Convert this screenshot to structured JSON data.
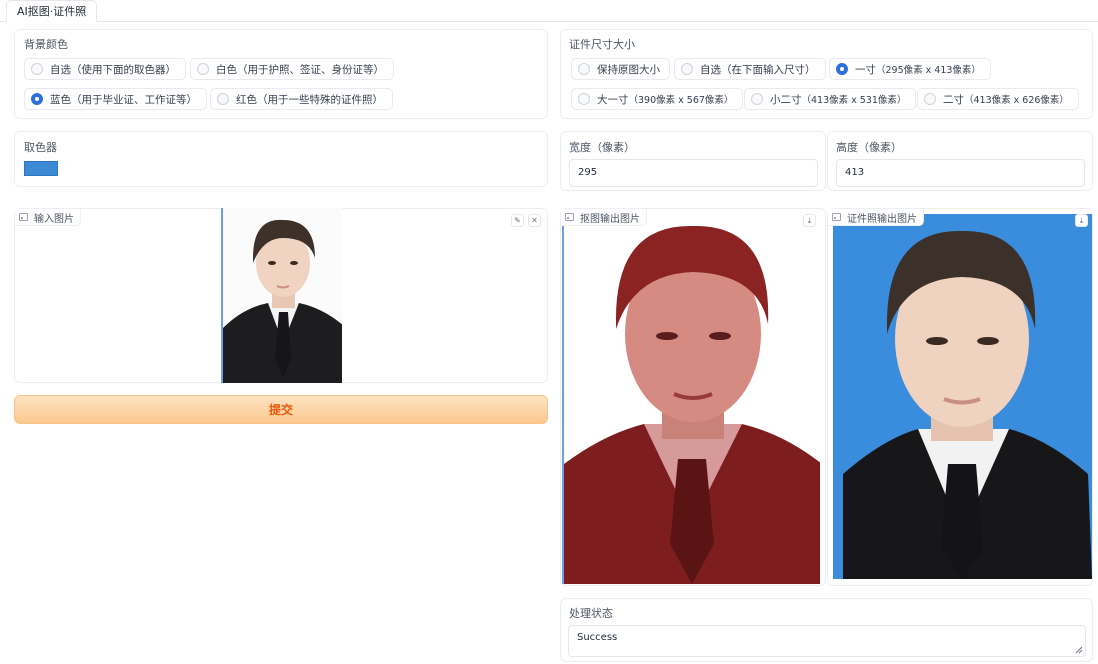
{
  "tab": {
    "title": "AI抠图·证件照"
  },
  "background": {
    "label": "背景颜色",
    "options": [
      {
        "label": "自选（使用下面的取色器）",
        "selected": false
      },
      {
        "label": "白色（用于护照、签证、身份证等）",
        "selected": false
      },
      {
        "label": "蓝色（用于毕业证、工作证等）",
        "selected": true
      },
      {
        "label": "红色（用于一些特殊的证件照）",
        "selected": false
      }
    ]
  },
  "size": {
    "label": "证件尺寸大小",
    "options": [
      {
        "label": "保持原图大小",
        "selected": false
      },
      {
        "label": "自选（在下面输入尺寸）",
        "selected": false
      },
      {
        "label": "一寸",
        "detail": "（295像素 x 413像素）",
        "selected": true
      },
      {
        "label": "大一寸",
        "detail": "（390像素 x 567像素）",
        "selected": false
      },
      {
        "label": "小二寸",
        "detail": "（413像素 x 531像素）",
        "selected": false
      },
      {
        "label": "二寸",
        "detail": "（413像素 x 626像素）",
        "selected": false
      }
    ]
  },
  "picker": {
    "label": "取色器",
    "color": "#3c89d6"
  },
  "width": {
    "label": "宽度（像素）",
    "value": "295"
  },
  "height": {
    "label": "高度（像素）",
    "value": "413"
  },
  "input_image": {
    "label": "输入图片",
    "edit_icon": "pencil-icon",
    "clear_icon": "close-icon"
  },
  "cutout_image": {
    "label": "抠图输出图片",
    "download_icon": "download-icon"
  },
  "idphoto_image": {
    "label": "证件照输出图片",
    "download_icon": "download-icon",
    "background": "#3a8cdc"
  },
  "submit": {
    "label": "提交"
  },
  "status": {
    "label": "处理状态",
    "value": "Success"
  },
  "colors": {
    "accent": "#2f6fdd",
    "submit_text": "#ea580c",
    "cutout_tint": "#a51f1f"
  }
}
